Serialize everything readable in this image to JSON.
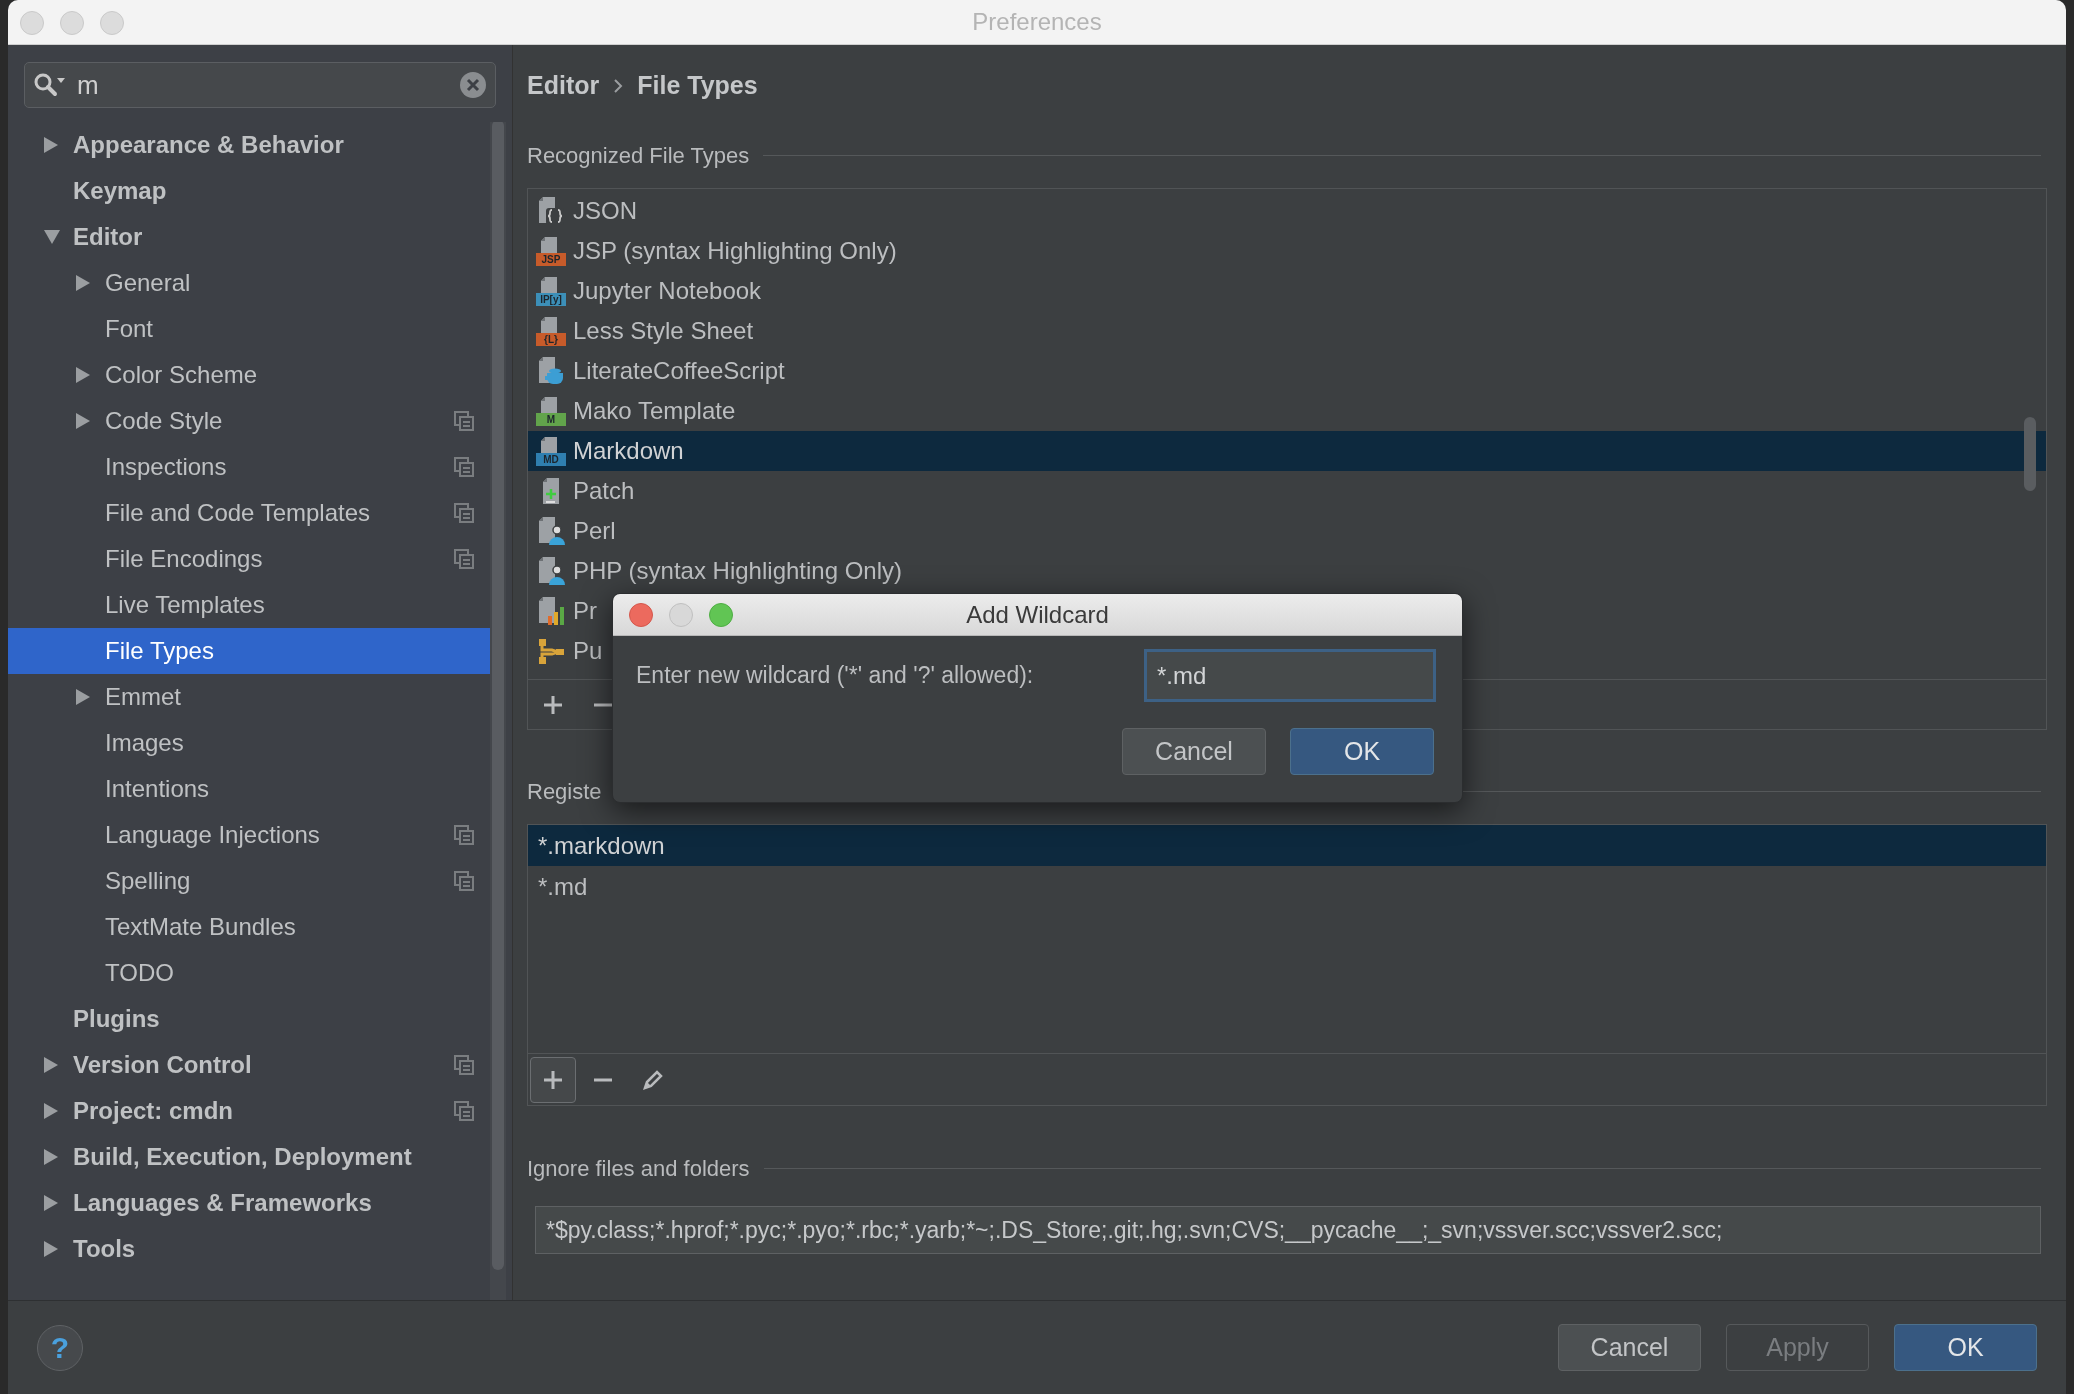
{
  "window": {
    "title": "Preferences"
  },
  "search": {
    "value": "m"
  },
  "sidebar": {
    "items": [
      {
        "label": "Appearance & Behavior",
        "expanded": false,
        "per_project": false,
        "selected": false
      },
      {
        "label": "Keymap",
        "per_project": false,
        "selected": false
      },
      {
        "label": "Editor",
        "expanded": true,
        "per_project": false,
        "selected": false,
        "children": [
          {
            "label": "General",
            "expanded": false,
            "per_project": false,
            "selected": false
          },
          {
            "label": "Font",
            "per_project": false,
            "selected": false
          },
          {
            "label": "Color Scheme",
            "expanded": false,
            "per_project": false,
            "selected": false
          },
          {
            "label": "Code Style",
            "expanded": false,
            "per_project": true,
            "selected": false
          },
          {
            "label": "Inspections",
            "per_project": true,
            "selected": false
          },
          {
            "label": "File and Code Templates",
            "per_project": true,
            "selected": false
          },
          {
            "label": "File Encodings",
            "per_project": true,
            "selected": false
          },
          {
            "label": "Live Templates",
            "per_project": false,
            "selected": false
          },
          {
            "label": "File Types",
            "per_project": false,
            "selected": true
          },
          {
            "label": "Emmet",
            "expanded": false,
            "per_project": false,
            "selected": false
          },
          {
            "label": "Images",
            "per_project": false,
            "selected": false
          },
          {
            "label": "Intentions",
            "per_project": false,
            "selected": false
          },
          {
            "label": "Language Injections",
            "per_project": true,
            "selected": false
          },
          {
            "label": "Spelling",
            "per_project": true,
            "selected": false
          },
          {
            "label": "TextMate Bundles",
            "per_project": false,
            "selected": false
          },
          {
            "label": "TODO",
            "per_project": false,
            "selected": false
          }
        ]
      },
      {
        "label": "Plugins",
        "per_project": false,
        "selected": false
      },
      {
        "label": "Version Control",
        "expanded": false,
        "per_project": true,
        "selected": false
      },
      {
        "label": "Project: cmdn",
        "expanded": false,
        "per_project": true,
        "selected": false
      },
      {
        "label": "Build, Execution, Deployment",
        "expanded": false,
        "per_project": false,
        "selected": false
      },
      {
        "label": "Languages & Frameworks",
        "expanded": false,
        "per_project": false,
        "selected": false
      },
      {
        "label": "Tools",
        "expanded": false,
        "per_project": false,
        "selected": false
      }
    ]
  },
  "breadcrumb": [
    "Editor",
    "File Types"
  ],
  "recognized": {
    "title": "Recognized File Types",
    "items": [
      {
        "label": "JSON",
        "kind": "json",
        "selected": false
      },
      {
        "label": "JSP (syntax Highlighting Only)",
        "kind": "badge",
        "badge": "JSP",
        "color": "#c75b2a",
        "selected": false
      },
      {
        "label": "Jupyter Notebook",
        "kind": "badge",
        "badge": "IP[y]",
        "color": "#3c8fb8",
        "selected": false
      },
      {
        "label": "Less Style Sheet",
        "kind": "badge",
        "badge": "{L}",
        "color": "#c75b2a",
        "selected": false
      },
      {
        "label": "LiterateCoffeeScript",
        "kind": "coffee",
        "selected": false
      },
      {
        "label": "Mako Template",
        "kind": "badge",
        "badge": "M",
        "color": "#62a44b",
        "selected": false
      },
      {
        "label": "Markdown",
        "kind": "badge",
        "badge": "MD",
        "color": "#2f7fb0",
        "selected": true
      },
      {
        "label": "Patch",
        "kind": "patch",
        "selected": false
      },
      {
        "label": "Perl",
        "kind": "person",
        "selected": false
      },
      {
        "label": "PHP (syntax Highlighting Only)",
        "kind": "person",
        "selected": false
      },
      {
        "label": "Pr",
        "kind": "chart",
        "selected": false
      },
      {
        "label": "Pu",
        "kind": "branch",
        "selected": false
      }
    ]
  },
  "patterns": {
    "title": "Registe",
    "items": [
      {
        "label": "*.markdown",
        "selected": true
      },
      {
        "label": "*.md",
        "selected": false
      }
    ]
  },
  "ignore": {
    "title": "Ignore files and folders",
    "value": "*$py.class;*.hprof;*.pyc;*.pyo;*.rbc;*.yarb;*~;.DS_Store;.git;.hg;.svn;CVS;__pycache__;_svn;vssver.scc;vssver2.scc;"
  },
  "dialog": {
    "title": "Add Wildcard",
    "label": "Enter new wildcard ('*' and '?' allowed):",
    "value": "*.md",
    "focused": true,
    "buttons": [
      {
        "label": "Cancel",
        "kind": "default"
      },
      {
        "label": "OK",
        "kind": "primary"
      }
    ]
  },
  "help": "?",
  "buttons": [
    {
      "label": "Cancel",
      "kind": "default",
      "disabled": false
    },
    {
      "label": "Apply",
      "kind": "default",
      "disabled": true
    },
    {
      "label": "OK",
      "kind": "primary",
      "disabled": false
    }
  ]
}
